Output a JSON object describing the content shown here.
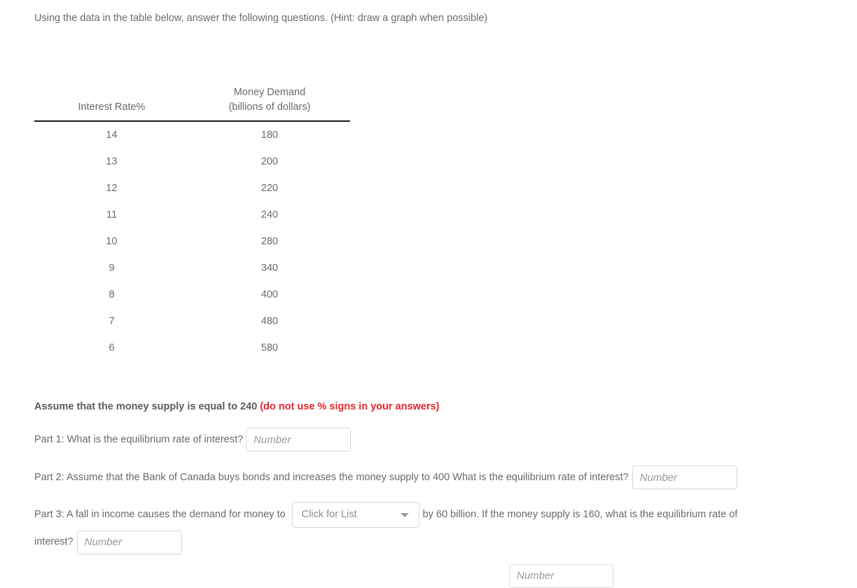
{
  "intro": {
    "text": "Using the data in the table below, answer the following questions. (Hint: draw a graph when possible)"
  },
  "table": {
    "headers": {
      "col1": "Interest Rate%",
      "col2_line1": "Money Demand",
      "col2_line2": "(billions of dollars)"
    },
    "rows": [
      {
        "rate": "14",
        "demand": "180"
      },
      {
        "rate": "13",
        "demand": "200"
      },
      {
        "rate": "12",
        "demand": "220"
      },
      {
        "rate": "11",
        "demand": "240"
      },
      {
        "rate": "10",
        "demand": "280"
      },
      {
        "rate": "9",
        "demand": "340"
      },
      {
        "rate": "8",
        "demand": "400"
      },
      {
        "rate": "7",
        "demand": "480"
      },
      {
        "rate": "6",
        "demand": "580"
      }
    ]
  },
  "assume": {
    "main": "Assume that the money supply is equal to 240 ",
    "warning": "(do not use % signs in your answers)",
    "warning_color": "#e8252a"
  },
  "part1": {
    "text": "Part 1: What is the equilibrium rate of interest?",
    "input_placeholder": "Number",
    "input_value": ""
  },
  "part2": {
    "text": "Part 2: Assume that the Bank of Canada buys bonds and increases the money supply to 400 What is the equilibrium rate of interest?",
    "input_placeholder": "Number",
    "input_value": ""
  },
  "part3": {
    "text_before": "Part 3: A fall in income causes the demand for money to",
    "dropdown_label": "Click for List",
    "text_after": "by 60 billion. If the money supply is 160, what is the equilibrium rate of interest?",
    "input_placeholder": "Number",
    "input_value": ""
  },
  "partial_bottom": {
    "input_placeholder": "Number",
    "input_value": ""
  },
  "chart_data": {
    "type": "table",
    "title": "Money Demand Schedule",
    "columns": [
      "Interest Rate%",
      "Money Demand (billions of dollars)"
    ],
    "x": [
      14,
      13,
      12,
      11,
      10,
      9,
      8,
      7,
      6
    ],
    "values": [
      180,
      200,
      220,
      240,
      280,
      340,
      400,
      480,
      580
    ],
    "xlabel": "Interest Rate%",
    "ylabel": "Money Demand (billions of dollars)"
  }
}
